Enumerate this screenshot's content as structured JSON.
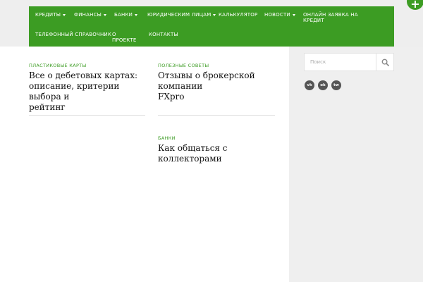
{
  "nav": {
    "items": [
      {
        "label": "КРЕДИТЫ",
        "dropdown": true
      },
      {
        "label": "ФИНАНСЫ",
        "dropdown": true
      },
      {
        "label": "БАНКИ",
        "dropdown": true
      },
      {
        "label": "ЮРИДИЧЕСКИМ ЛИЦАМ",
        "dropdown": true
      },
      {
        "label": "КАЛЬКУЛЯТОР",
        "dropdown": false
      },
      {
        "label": "НОВОСТИ",
        "dropdown": true
      },
      {
        "label": "ОНЛАЙН ЗАЯВКА НА",
        "label2": "КРЕДИТ",
        "dropdown": false
      },
      {
        "label": "ТЕЛЕФОННЫЙ СПРАВОЧНИК",
        "dropdown": false
      },
      {
        "label": "О",
        "label2": "ПРОЕКТЕ",
        "dropdown": false
      },
      {
        "label": "КОНТАКТЫ",
        "dropdown": false
      }
    ]
  },
  "fab": {
    "icon": "plus-icon",
    "symbol": "+"
  },
  "posts": [
    {
      "category": "ПЛАСТИКОВЫЕ КАРТЫ",
      "title_lines": [
        "Все о дебетовых картах:",
        "описание, критерии выбора и",
        "рейтинг"
      ]
    },
    {
      "category": "ПОЛЕЗНЫЕ СОВЕТЫ",
      "title_lines": [
        "Отзывы о брокерской компании",
        "FXpro"
      ]
    },
    {
      "category": "БАНКИ",
      "title_lines": [
        "Как общаться с коллекторами"
      ]
    }
  ],
  "sidebar": {
    "search": {
      "placeholder": "Поиск",
      "value": "",
      "icon": "search-icon"
    },
    "social": [
      {
        "icon": "vk-icon",
        "text": "vk"
      },
      {
        "icon": "odnoklassniki-icon",
        "text": "ok"
      },
      {
        "icon": "twitter-icon",
        "text": "tw"
      }
    ]
  },
  "colors": {
    "accent": "#3c9c23",
    "nav_text": "#ffffff",
    "sidebar_bg": "#efefef",
    "social_bg": "#555555"
  }
}
